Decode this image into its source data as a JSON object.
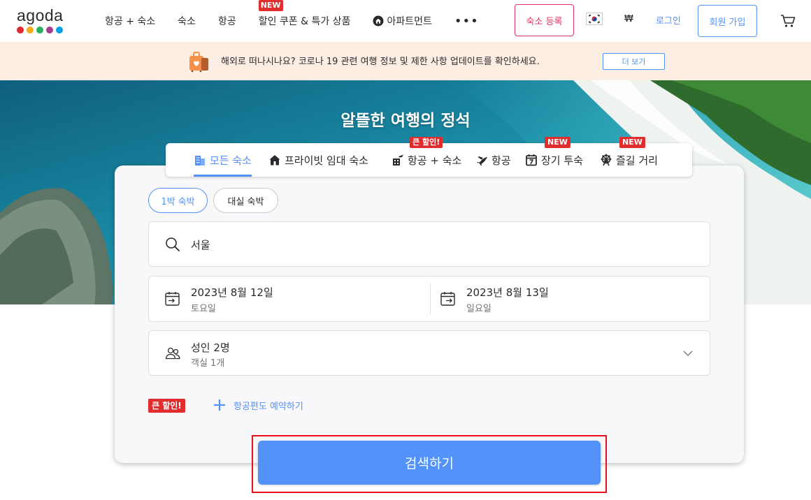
{
  "header": {
    "logo_text": "agoda",
    "logo_colors": [
      "#e2282c",
      "#f4ae1d",
      "#2ab15d",
      "#a53d8f",
      "#00a0e1"
    ],
    "nav": [
      {
        "label": "항공 + 숙소",
        "badge": ""
      },
      {
        "label": "숙소",
        "badge": ""
      },
      {
        "label": "항공",
        "badge": ""
      },
      {
        "label": "할인 쿠폰 & 특가 상품",
        "badge": "NEW"
      },
      {
        "label": "아파트먼트",
        "badge": ""
      }
    ],
    "more_label": "•••",
    "list_property": "숙소 등록",
    "currency": "₩",
    "login": "로그인",
    "signup": "회원 가입"
  },
  "notice": {
    "text": "해외로 떠나시나요? 코로나 19 관련 여행 정보 및 제한 사항 업데이트를 확인하세요.",
    "button": "더 보기"
  },
  "hero": {
    "title": "알뜰한 여행의 정석"
  },
  "tabs": [
    {
      "label": "모든 숙소",
      "badge": "",
      "active": true
    },
    {
      "label": "프라이빗 임대 숙소",
      "badge": "",
      "active": false
    },
    {
      "label": "항공 + 숙소",
      "badge": "큰 할인!",
      "active": false
    },
    {
      "label": "항공",
      "badge": "",
      "active": false
    },
    {
      "label": "장기 투숙",
      "badge": "NEW",
      "active": false
    },
    {
      "label": "즐길 거리",
      "badge": "NEW",
      "active": false
    }
  ],
  "stay_type": {
    "overnight": "1박 숙박",
    "dayuse": "대실 숙박"
  },
  "search": {
    "destination": "서울",
    "checkin_date": "2023년 8월 12일",
    "checkin_day": "토요일",
    "checkout_date": "2023년 8월 13일",
    "checkout_day": "일요일",
    "guests": "성인 2명",
    "rooms": "객실 1개"
  },
  "promo": {
    "badge": "큰 할인!",
    "add_flight": "항공편도 예약하기"
  },
  "search_button": "검색하기",
  "colors": {
    "brand_blue": "#5392f9",
    "accent_red": "#e12d2d",
    "highlight_red": "#e8111a",
    "list_property_pink": "#e0335e",
    "notice_bg": "#fdeee4"
  }
}
